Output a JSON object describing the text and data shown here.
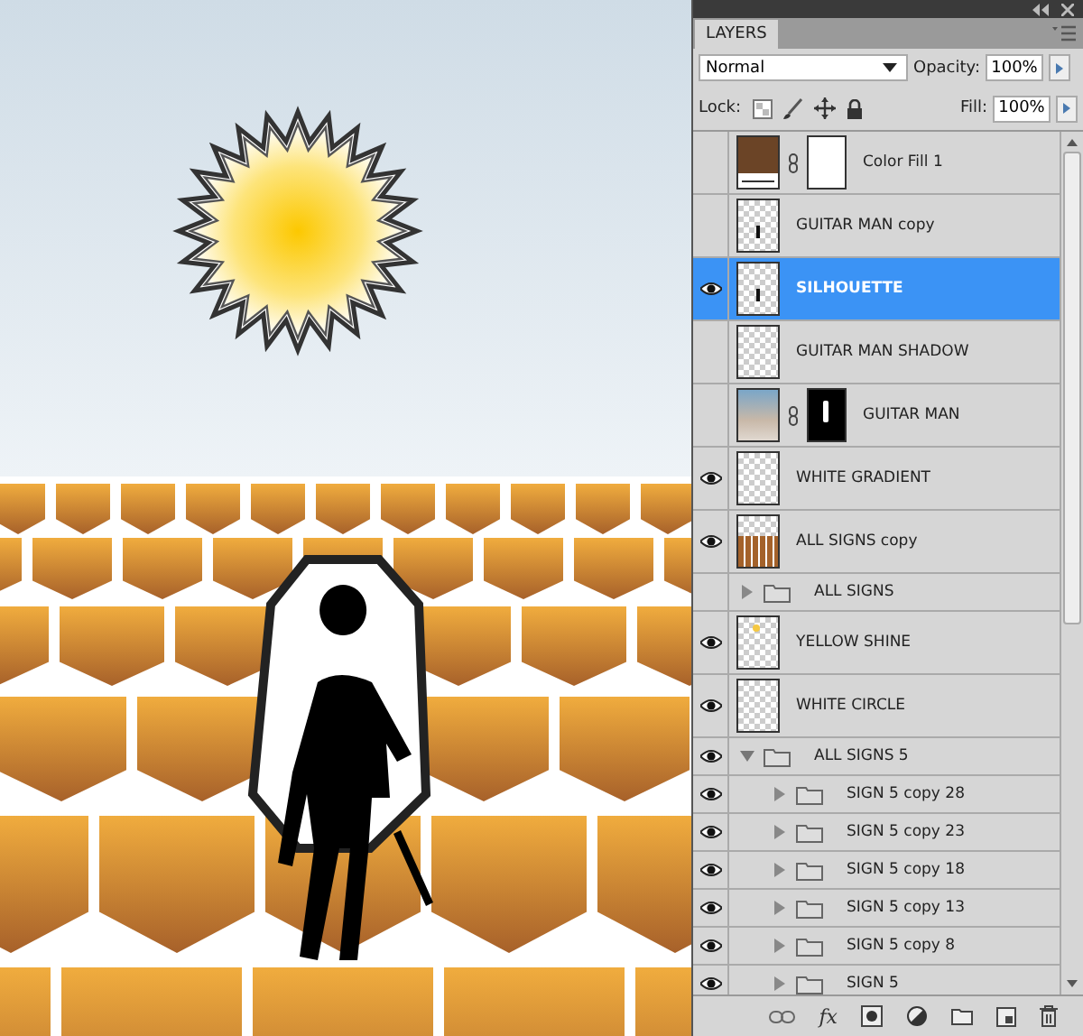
{
  "panel": {
    "tab": "LAYERS",
    "blend_mode": "Normal",
    "opacity_label": "Opacity:",
    "opacity": "100%",
    "lock_label": "Lock:",
    "fill_label": "Fill:",
    "fill": "100%"
  },
  "layers": [
    {
      "kind": "layer",
      "name": "Color Fill 1",
      "visible": false,
      "selected": false,
      "thumbnail": {
        "kind": "color-fill"
      },
      "mask": {
        "kind": "white"
      }
    },
    {
      "kind": "layer",
      "name": "GUITAR MAN copy",
      "visible": false,
      "selected": false,
      "thumbnail": {
        "kind": "figure"
      }
    },
    {
      "kind": "layer",
      "name": "SILHOUETTE",
      "visible": true,
      "selected": true,
      "thumbnail": {
        "kind": "figure"
      }
    },
    {
      "kind": "layer",
      "name": "GUITAR MAN SHADOW",
      "visible": false,
      "selected": false,
      "thumbnail": {
        "kind": "blank"
      }
    },
    {
      "kind": "layer",
      "name": "GUITAR MAN",
      "visible": false,
      "selected": false,
      "thumbnail": {
        "kind": "photo"
      },
      "mask": {
        "kind": "silhouette"
      }
    },
    {
      "kind": "layer",
      "name": "WHITE GRADIENT",
      "visible": true,
      "selected": false,
      "thumbnail": {
        "kind": "blank"
      }
    },
    {
      "kind": "layer",
      "name": "ALL SIGNS copy",
      "visible": true,
      "selected": false,
      "thumbnail": {
        "kind": "signs"
      }
    },
    {
      "kind": "group",
      "name": "ALL SIGNS",
      "visible": false,
      "selected": false,
      "expanded": false
    },
    {
      "kind": "layer",
      "name": "YELLOW SHINE",
      "visible": true,
      "selected": false,
      "thumbnail": {
        "kind": "dot"
      }
    },
    {
      "kind": "layer",
      "name": "WHITE CIRCLE",
      "visible": true,
      "selected": false,
      "thumbnail": {
        "kind": "blank"
      }
    },
    {
      "kind": "group",
      "name": "ALL SIGNS 5",
      "visible": true,
      "selected": false,
      "expanded": true,
      "children": [
        {
          "kind": "group",
          "name": "SIGN 5 copy 28",
          "visible": true,
          "selected": false,
          "expanded": false
        },
        {
          "kind": "group",
          "name": "SIGN 5 copy 23",
          "visible": true,
          "selected": false,
          "expanded": false
        },
        {
          "kind": "group",
          "name": "SIGN 5 copy 18",
          "visible": true,
          "selected": false,
          "expanded": false
        },
        {
          "kind": "group",
          "name": "SIGN 5 copy 13",
          "visible": true,
          "selected": false,
          "expanded": false
        },
        {
          "kind": "group",
          "name": "SIGN 5 copy 8",
          "visible": true,
          "selected": false,
          "expanded": false
        },
        {
          "kind": "group",
          "name": "SIGN 5",
          "visible": true,
          "selected": false,
          "expanded": false
        }
      ]
    }
  ],
  "footer": {
    "effects": "fx"
  }
}
